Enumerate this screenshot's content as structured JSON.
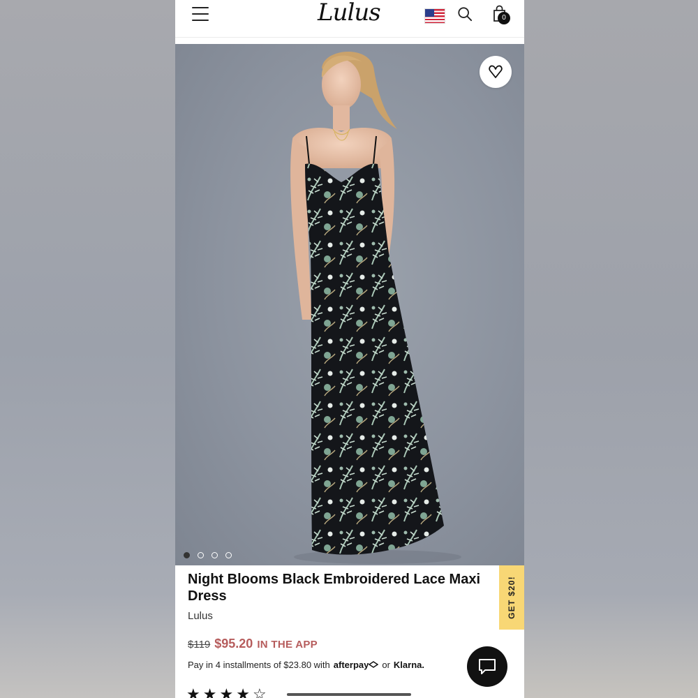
{
  "header": {
    "logo": "Lulus",
    "cart_count": "0"
  },
  "product": {
    "title": "Night Blooms Black Embroidered Lace Maxi Dress",
    "brand": "Lulus",
    "old_price": "$119",
    "new_price": "$95.20",
    "app_note": "IN THE APP",
    "installments_text": "Pay in 4 installments of $23.80 with",
    "afterpay_label": "afterpay",
    "or_label": "or",
    "klarna_label": "Klarna."
  },
  "promo_tab": "GET $20!",
  "carousel": {
    "active_index": 0,
    "count": 4
  },
  "rating": {
    "stars_filled": 4,
    "stars_total": 5
  },
  "icons": {
    "menu": "menu-icon",
    "flag": "us-flag-icon",
    "search": "search-icon",
    "bag": "shopping-bag-icon",
    "favorite": "heart-icon",
    "chat": "chat-icon"
  },
  "colors": {
    "sale_price": "#b65c5c",
    "promo_tab": "#f8d775"
  }
}
